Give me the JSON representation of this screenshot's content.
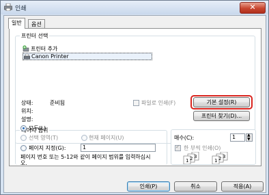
{
  "window": {
    "title": "인쇄",
    "close_label": "✕"
  },
  "tabs": [
    "일반",
    "옵션"
  ],
  "printer_select": {
    "title": "프린터 선택",
    "items": [
      "프린터 추가",
      "Canon Printer"
    ]
  },
  "status": {
    "status_label": "상태:",
    "status_value": "준비됨",
    "location_label": "위치:",
    "comment_label": "설명:",
    "print_to_file": "파일로 인쇄(F)",
    "preferences": "기본 설정(R)",
    "find_printer": "프린터 찾기(D)..."
  },
  "page_range": {
    "title": "페이지 범위",
    "all": "모두(L)",
    "selection": "선택 영역(T)",
    "current_page": "현재 페이지(U)",
    "pages": "페이지 지정(G):",
    "pages_value": "1",
    "help": "페이지 번호 또는 5-12와 같이 페이지 범위를 입력하십시오."
  },
  "copies": {
    "label": "매수(C):",
    "value": "1",
    "collate": "한 부씩 인쇄(O)",
    "collate_icon": "collate-pages-icon"
  },
  "footer": {
    "print": "인쇄(P)",
    "cancel": "취소",
    "apply": "적용(A)"
  },
  "accent": {
    "highlight": "#d9231d",
    "title_bar": "#c9d8ec"
  }
}
